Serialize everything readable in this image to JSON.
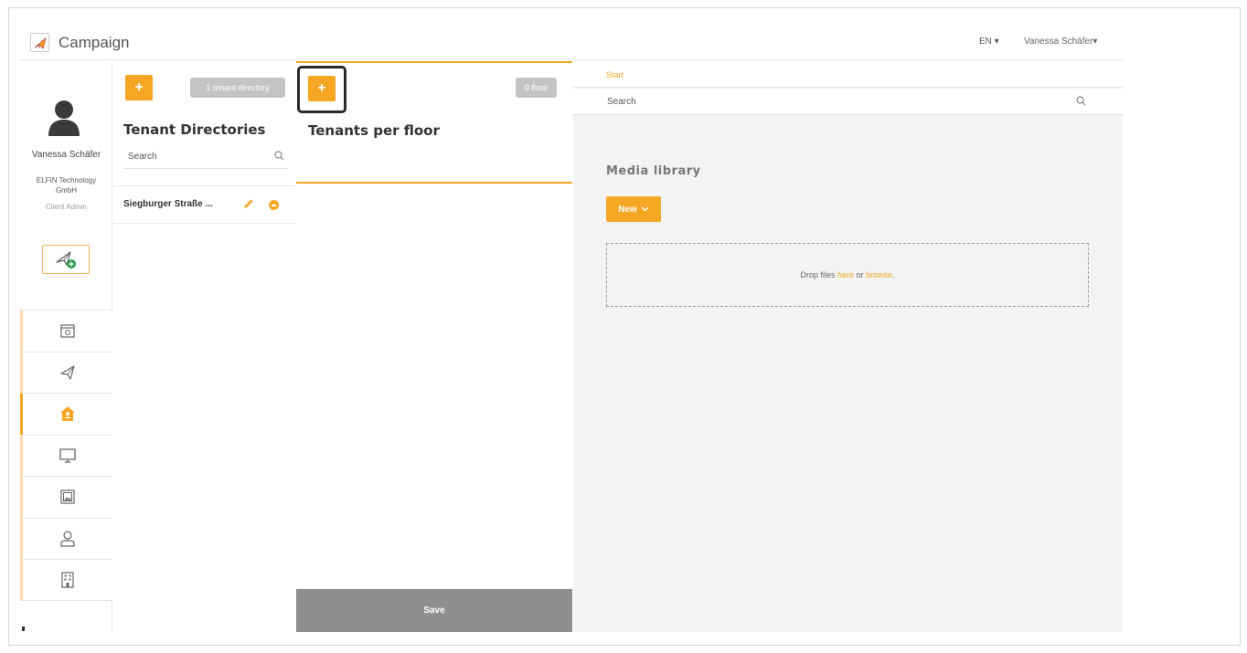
{
  "header": {
    "app_title": "Campaign",
    "language": "EN",
    "user_menu": "Vanessa Schäfer"
  },
  "sidebar": {
    "user_name": "Vanessa Schäfer",
    "company": "ELFIN Technology GmbH",
    "role": "Client Admin",
    "nav_items": [
      {
        "icon": "calendar-icon",
        "active": false
      },
      {
        "icon": "paper-plane-icon",
        "active": false
      },
      {
        "icon": "house-icon",
        "active": true
      },
      {
        "icon": "monitor-icon",
        "active": false
      },
      {
        "icon": "image-frame-icon",
        "active": false
      },
      {
        "icon": "user-icon",
        "active": false
      },
      {
        "icon": "building-icon",
        "active": false
      }
    ]
  },
  "tenant_directories": {
    "add_label": "+",
    "count_badge": "1 tenant directory",
    "title": "Tenant Directories",
    "search_placeholder": "Search",
    "items": [
      {
        "name": "Siegburger Straße ..."
      }
    ]
  },
  "tenants_per_floor": {
    "add_label": "+",
    "count_badge": "0 floor",
    "title": "Tenants per floor",
    "save_label": "Save"
  },
  "media": {
    "breadcrumb": "Start",
    "search_placeholder": "Search",
    "title": "Media library",
    "new_button": "New",
    "drop_prefix": "Drop files ",
    "drop_here": "here",
    "drop_or": " or ",
    "drop_browse": "browse",
    "drop_suffix": "."
  },
  "colors": {
    "accent": "#f5a623",
    "panel_bg": "#f2f4f4",
    "save_bar": "#8f8f8f"
  }
}
